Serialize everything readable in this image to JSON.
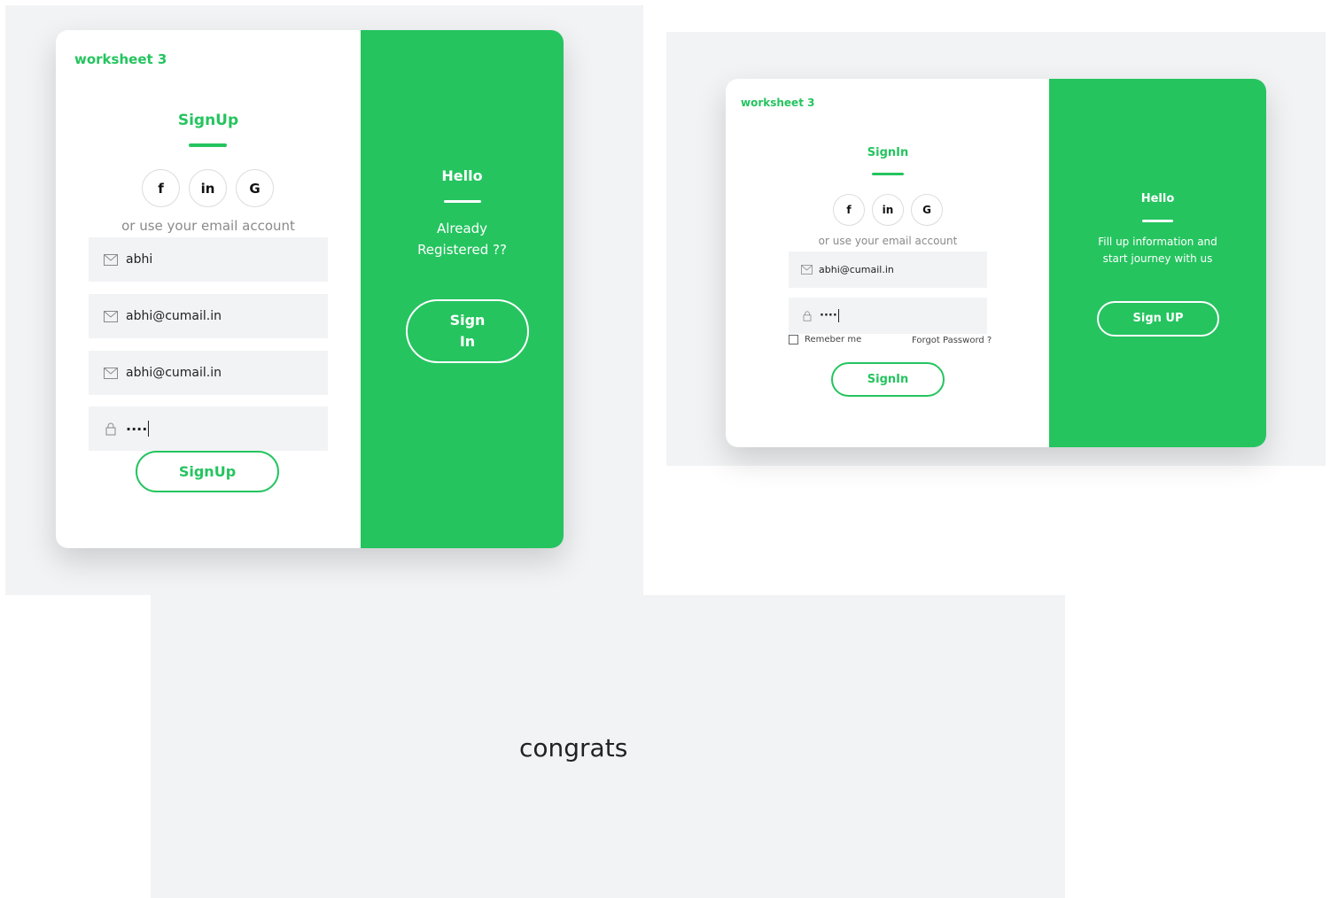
{
  "brand": {
    "color": "#25c45f",
    "name": "worksheet 3"
  },
  "social_icons": [
    {
      "icon": "facebook-icon",
      "glyph": "f"
    },
    {
      "icon": "linkedin-icon",
      "glyph": "in"
    },
    {
      "icon": "google-icon",
      "glyph": "G"
    }
  ],
  "signup": {
    "title": "SignUp",
    "hint": "or use your email account",
    "fields": [
      {
        "icon": "mail-icon",
        "value": "abhi"
      },
      {
        "icon": "mail-icon",
        "value": "abhi@cumail.in"
      },
      {
        "icon": "mail-icon",
        "value": "abhi@cumail.in"
      },
      {
        "icon": "lock-icon",
        "value": "····"
      }
    ],
    "button": "SignUp",
    "side": {
      "title": "Hello",
      "text_line1": "Already",
      "text_line2": "Registered ??",
      "button_line1": "Sign",
      "button_line2": "In"
    }
  },
  "signin": {
    "title": "SignIn",
    "hint": "or use your email account",
    "fields": [
      {
        "icon": "mail-icon",
        "value": "abhi@cumail.in"
      },
      {
        "icon": "lock-icon",
        "value": "····"
      }
    ],
    "remember_label": "Remeber me",
    "forgot_label": "Forgot Password ?",
    "button": "SignIn",
    "side": {
      "title": "Hello",
      "text_line1": "Fill up information and",
      "text_line2": "start journey with us",
      "button": "Sign UP"
    }
  },
  "congrats": {
    "message": "congrats"
  }
}
